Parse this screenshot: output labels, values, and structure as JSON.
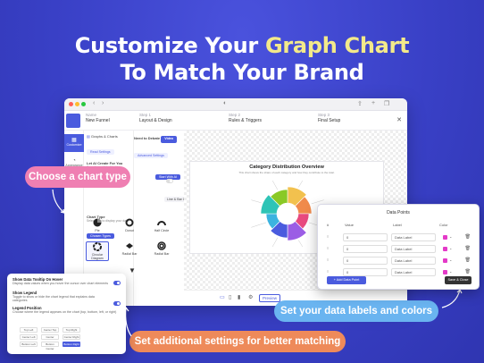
{
  "headline": {
    "part1": "Customize Your ",
    "highlight": "Graph Chart",
    "line2": "To Match Your Brand"
  },
  "window": {
    "project_label": "Name",
    "project_name": "New Funnel",
    "steps": [
      {
        "num": "Step 1",
        "label": "Layout & Design"
      },
      {
        "num": "Step 2",
        "label": "Rules & Triggers"
      },
      {
        "num": "Step 3",
        "label": "Final Setup"
      }
    ],
    "leftnav": [
      {
        "label": "Customize"
      },
      {
        "label": "Appearance"
      }
    ],
    "panel": {
      "section": "Graphs & Charts",
      "tab": "Read Settings",
      "ai_title": "Let AI Create For You",
      "ai_desc": "Save time - AI builds it in seconds",
      "ai_button": "Start With AI",
      "need_lab": "Need to Debate",
      "need_tag": "Video",
      "adv": "Advanced Settings",
      "title_label": "Title",
      "chart_type_label": "Chart Type",
      "chart_type_desc": "Select how to display your data",
      "tabs": [
        "Chosen Types",
        "Line & Bar Charts"
      ],
      "types": [
        "Pie",
        "Donut",
        "Half Circle",
        "Circular Diagram",
        "Radial Bar",
        "Radial Bar"
      ]
    },
    "chart": {
      "title": "Category Distribution Overview",
      "subtitle": "This chart shows the share of each category and how they contribute to the total."
    },
    "bottombar": {
      "preview": "Preview"
    }
  },
  "callouts": {
    "chart_type": "Choose a chart type",
    "data_labels": "Set your data labels and colors",
    "settings": "Set additional settings for better matching"
  },
  "data_points": {
    "title": "Data Points",
    "headers": {
      "num": "#",
      "value": "Value",
      "label": "Label",
      "color": "Color"
    },
    "rows": [
      {
        "value": "0",
        "label": "Data Label"
      },
      {
        "value": "0",
        "label": "Data Label"
      },
      {
        "value": "0",
        "label": "Data Label"
      },
      {
        "value": "0",
        "label": "Data Label"
      }
    ],
    "add_button": "+ Add Data Point",
    "save_button": "Save & Close",
    "swatch_color": "#e43ac8"
  },
  "settings": {
    "tooltip_title": "Show Data Tooltip On Hover",
    "tooltip_desc": "Display data values when you hover the cursor over chart elements",
    "legend_title": "Show Legend",
    "legend_desc": "Toggle to show or hide the chart legend that explains data categories",
    "legend_pos_title": "Legend Position",
    "legend_pos_desc": "Choose where the legend appears on the chart (top, bottom, left, or right)",
    "positions": [
      "Top Left",
      "Center Top",
      "Top Right",
      "Center Left",
      "Center",
      "Center Right",
      "Bottom Left",
      "Bottom Center",
      "Bottom Right"
    ]
  },
  "colors": {
    "accent": "#4a5bde",
    "pink": "#ef7fb2",
    "blue": "#6ab4f0",
    "orange": "#ee8a5a",
    "background": "#3b41c9",
    "highlight": "#f3e98a"
  }
}
